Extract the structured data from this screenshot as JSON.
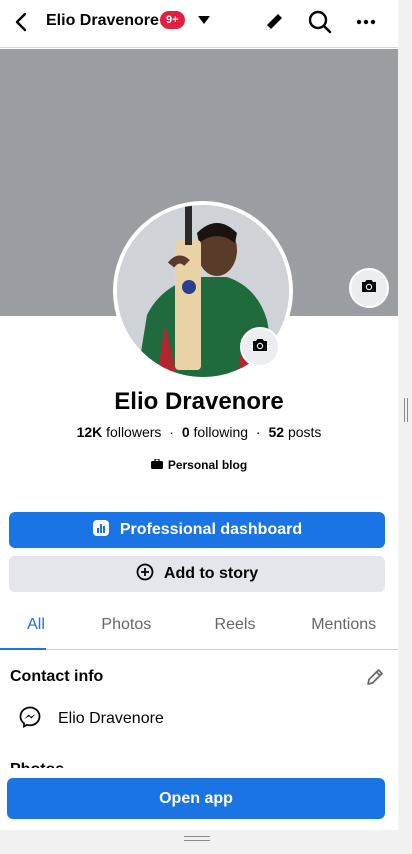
{
  "header": {
    "back_icon": "arrow-left-icon",
    "name": "Elio Dravenore",
    "notification_badge": "9+",
    "icons": [
      "pencil-icon",
      "search-icon",
      "more-icon"
    ]
  },
  "profile": {
    "name": "Elio Dravenore",
    "followers_count": "12K",
    "followers_label": "followers",
    "following_count": "0",
    "following_label": "following",
    "posts_count": "52",
    "posts_label": "posts",
    "separator": "·",
    "category": "Personal blog"
  },
  "actions": {
    "dashboard_label": "Professional dashboard",
    "story_label": "Add to story"
  },
  "tabs": [
    {
      "label": "All",
      "active": true
    },
    {
      "label": "Photos",
      "active": false
    },
    {
      "label": "Reels",
      "active": false
    },
    {
      "label": "Mentions",
      "active": false
    }
  ],
  "contact": {
    "title": "Contact info",
    "messenger_name": "Elio Dravenore"
  },
  "photos_section": {
    "title": "Photos"
  },
  "footer": {
    "open_app_label": "Open app"
  },
  "colors": {
    "accent": "#1b74e4",
    "badge": "#e41e3f",
    "cover": "#9a9ea3"
  }
}
